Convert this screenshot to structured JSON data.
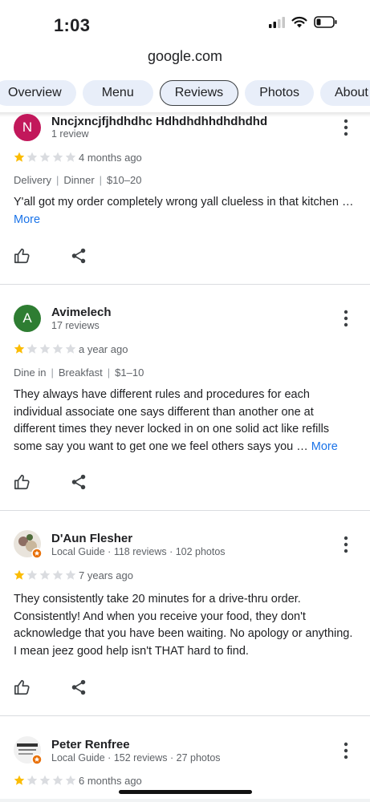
{
  "status": {
    "time": "1:03"
  },
  "browser": {
    "url": "google.com"
  },
  "tabs": [
    {
      "label": "Overview"
    },
    {
      "label": "Menu"
    },
    {
      "label": "Reviews",
      "active": true
    },
    {
      "label": "Photos"
    },
    {
      "label": "About"
    }
  ],
  "reviews": [
    {
      "avatar_letter": "N",
      "avatar_color": "#c2185b",
      "name": "Nncjxncjfjhdhdhc Hdhdhdhhdhdhdhd",
      "meta": "1 review",
      "rating": 1,
      "when": "4 months ago",
      "tags": [
        "Delivery",
        "Dinner",
        "$10–20"
      ],
      "text": "Y'all got my order completely wrong yall clueless in that kitchen …",
      "more": "More"
    },
    {
      "avatar_letter": "A",
      "avatar_color": "#2e7d32",
      "name": "Avimelech",
      "meta": "17 reviews",
      "rating": 1,
      "when": "a year ago",
      "tags": [
        "Dine in",
        "Breakfast",
        "$1–10"
      ],
      "text": "They always have different rules and procedures for each individual associate one says different than another one at different times they never locked in on one solid act like refills some say you want to get one we feel others says you …",
      "more": "More"
    },
    {
      "name": "D'Aun Flesher",
      "meta": "Local Guide · 118 reviews · 102 photos",
      "rating": 1,
      "when": "7 years ago",
      "text": "They consistently take 20 minutes for a drive-thru order. Consistently! And when you receive your food, they don't acknowledge that you have been waiting. No apology or anything. I mean jeez good help isn't THAT hard to find."
    },
    {
      "name": "Peter Renfree",
      "meta": "Local Guide · 152 reviews · 27 photos",
      "rating": 1,
      "when": "6 months ago"
    }
  ],
  "colors": {
    "star_filled": "#fbbc04",
    "star_empty": "#dadce0",
    "link": "#1a73e8",
    "local_guide_badge": "#e8710a"
  }
}
